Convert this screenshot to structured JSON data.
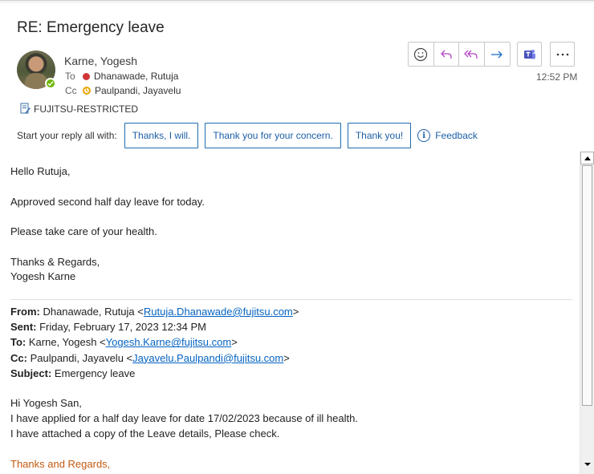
{
  "email": {
    "subject": "RE: Emergency leave",
    "sender": "Karne, Yogesh",
    "to_label": "To",
    "to_name": "Dhanawade, Rutuja",
    "cc_label": "Cc",
    "cc_name": "Paulpandi, Jayavelu",
    "time": "12:52 PM",
    "classification": "FUJITSU-RESTRICTED"
  },
  "actions": {
    "icons": [
      "emoji-reaction-icon",
      "reply-icon",
      "reply-all-icon",
      "forward-icon",
      "teams-icon",
      "more-icon"
    ]
  },
  "quick_replies": {
    "prompt": "Start your reply all with:",
    "options": [
      "Thanks, I will.",
      "Thank you for your concern.",
      "Thank you!"
    ],
    "feedback": "Feedback"
  },
  "body": {
    "greeting": "Hello Rutuja,",
    "line1": "Approved second half day leave for today.",
    "line2": "Please take care of your health.",
    "closing1": "Thanks & Regards,",
    "closing2": "Yogesh Karne"
  },
  "quoted_header": {
    "from_label": "From:",
    "from_name": " Dhanawade, Rutuja <",
    "from_email": "Rutuja.Dhanawade@fujitsu.com",
    "sent_label": "Sent:",
    "sent_value": " Friday, February 17, 2023 12:34 PM",
    "to_label": "To:",
    "to_name": " Karne, Yogesh <",
    "to_email": "Yogesh.Karne@fujitsu.com",
    "cc_label": "Cc:",
    "cc_name": " Paulpandi, Jayavelu <",
    "cc_email": "Jayavelu.Paulpandi@fujitsu.com",
    "subject_label": "Subject:",
    "subject_value": " Emergency leave",
    "close_bracket": ">"
  },
  "quoted_body": {
    "greeting": "Hi Yogesh San,",
    "line1": "I have applied for a half day leave for date 17/02/2023 because of ill health.",
    "line2": "I have attached a copy of the Leave details, Please check.",
    "signoff": "Thanks and Regards,"
  },
  "colors": {
    "accent": "#1b5fa7",
    "link": "#0563c1",
    "busy": "#d13438",
    "away": "#eaa300",
    "available": "#6bb700",
    "signoff": "#c55a11"
  }
}
